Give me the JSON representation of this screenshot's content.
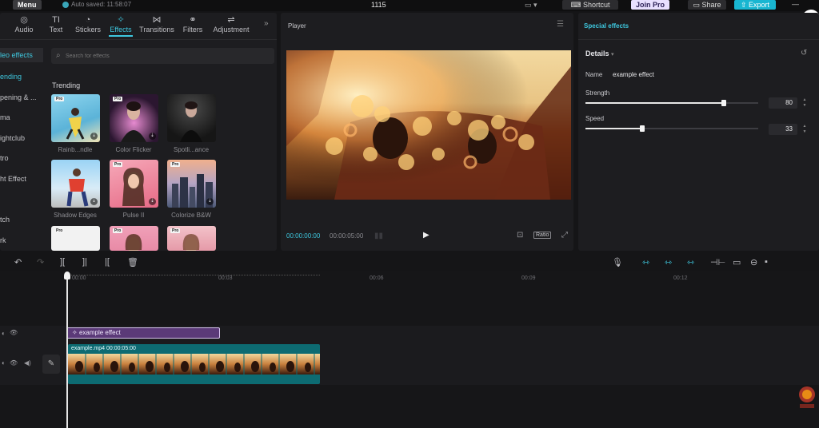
{
  "topbar": {
    "menu_label": "Menu",
    "autosave": "Auto saved: 11:58:07",
    "project_title": "1115",
    "shortcut_label": "Shortcut",
    "joinpro_label": "Join Pro",
    "share_label": "Share",
    "export_label": "Export"
  },
  "tools": [
    {
      "label": "Audio",
      "icon": "audio-icon"
    },
    {
      "label": "Text",
      "icon": "text-icon"
    },
    {
      "label": "Stickers",
      "icon": "stickers-icon"
    },
    {
      "label": "Effects",
      "icon": "effects-icon"
    },
    {
      "label": "Transitions",
      "icon": "transitions-icon"
    },
    {
      "label": "Filters",
      "icon": "filters-icon"
    },
    {
      "label": "Adjustment",
      "icon": "adjustment-icon"
    }
  ],
  "categories": [
    "leo effects",
    "ending",
    "pening & ...",
    "ma",
    "ightclub",
    "tro",
    "ht Effect",
    "tch",
    "rk"
  ],
  "search": {
    "placeholder": "Search for effects"
  },
  "section_title": "Trending",
  "effect_cards": [
    {
      "label": "Rainb...ndle"
    },
    {
      "label": "Color Flicker"
    },
    {
      "label": "Spotli...ance"
    },
    {
      "label": "Shadow Edges"
    },
    {
      "label": "Pulse II"
    },
    {
      "label": "Colorize B&W"
    },
    {
      "label": ""
    },
    {
      "label": ""
    },
    {
      "label": ""
    }
  ],
  "player": {
    "title": "Player",
    "time_current": "00:00:00:00",
    "time_total": "00:00:05:00",
    "ratio_label": "Ratio"
  },
  "special_effects": {
    "title": "Special effects",
    "details_label": "Details",
    "name_label": "Name",
    "name_value": "example effect",
    "strength_label": "Strength",
    "strength_value": "80",
    "strength_level": 0.8,
    "speed_label": "Speed",
    "speed_value": "33",
    "speed_level": 0.33
  },
  "timeline": {
    "ruler": [
      "00:00",
      "00:03",
      "00:06",
      "00:09",
      "00:12"
    ],
    "effect_clip_label": "example effect",
    "video_clip_label": "example.mp4  00:00:05:00"
  }
}
